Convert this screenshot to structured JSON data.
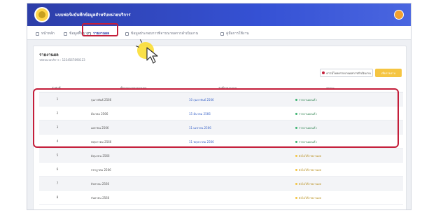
{
  "app": {
    "title": "แบบฟอร์มบันทึกข้อมูลสำหรับหน่วยบริการ",
    "colors": {
      "header": "#2d3ea8",
      "highlight": "#c41e3a",
      "link": "#3a64c8",
      "success": "#3cb371",
      "pending": "#f5c542"
    }
  },
  "menu": {
    "items": [
      {
        "label": "หน้าหลัก",
        "icon": "home-icon"
      },
      {
        "label": "ข้อมูลพื้นฐาน",
        "icon": "info-icon"
      },
      {
        "label": "รายงานผล",
        "icon": "report-icon",
        "active": true
      },
      {
        "label": "ข้อมูลประกอบการพิจารณาผลการดำเนินงาน",
        "icon": "document-icon"
      },
      {
        "label": "คู่มือการใช้งาน",
        "icon": "book-icon"
      }
    ]
  },
  "page": {
    "title": "รายงานผล",
    "subtitle": "รหัสหน่วยบริการ : 1234567890123",
    "export_button": "ดาวน์โหลดรายงานผลการดำเนินงาน",
    "add_button": "เพิ่มรายงาน"
  },
  "table": {
    "headers": [
      "ลำดับที่",
      "ชื่อรอบการรายงานผล",
      "วันที่รายงานผล",
      "สถานะ"
    ],
    "rows": [
      {
        "num": "1",
        "month": "กุมภาพันธ์ 2566",
        "date": "10 กุมภาพันธ์ 2566",
        "status": "รายงานผลแล้ว",
        "state": "done"
      },
      {
        "num": "2",
        "month": "มีนาคม 2566",
        "date": "15 มีนาคม 2566",
        "status": "รายงานผลแล้ว",
        "state": "done"
      },
      {
        "num": "3",
        "month": "เมษายน 2566",
        "date": "11 เมษายน 2566",
        "status": "รายงานผลแล้ว",
        "state": "done"
      },
      {
        "num": "4",
        "month": "พฤษภาคม 2566",
        "date": "11 พฤษภาคม 2566",
        "status": "รายงานผลแล้ว",
        "state": "done"
      },
      {
        "num": "5",
        "month": "มิถุนายน 2566",
        "date": "",
        "status": "ยังไม่ได้รายงานผล",
        "state": "pending"
      },
      {
        "num": "6",
        "month": "กรกฎาคม 2566",
        "date": "",
        "status": "ยังไม่ได้รายงานผล",
        "state": "pending"
      },
      {
        "num": "7",
        "month": "สิงหาคม 2566",
        "date": "",
        "status": "ยังไม่ได้รายงานผล",
        "state": "pending"
      },
      {
        "num": "8",
        "month": "กันยายน 2566",
        "date": "",
        "status": "ยังไม่ได้รายงานผล",
        "state": "pending"
      }
    ]
  }
}
